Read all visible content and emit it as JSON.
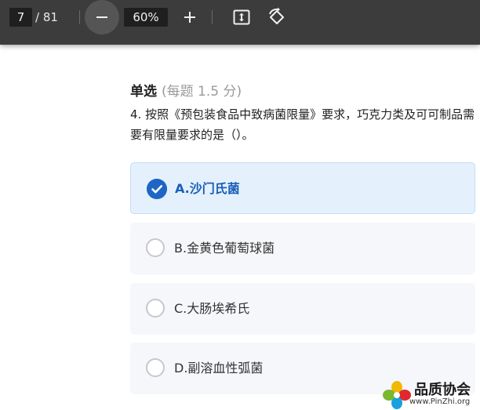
{
  "toolbar": {
    "current_page": "7",
    "page_total": "/ 81",
    "zoom": "60%",
    "zoom_out_icon": "minus-icon",
    "zoom_in_icon": "plus-icon",
    "fit_icon": "fit-to-page-icon",
    "rotate_icon": "rotate-icon"
  },
  "section": {
    "title": "单选",
    "meta": "(每题 1.5 分)"
  },
  "question": {
    "text": "4. 按照《预包装食品中致病菌限量》要求，巧克力类及可可制品需要有限量要求的是（）。"
  },
  "options": [
    {
      "label": "A.沙门氏菌",
      "selected": true
    },
    {
      "label": "B.金黄色葡萄球菌",
      "selected": false
    },
    {
      "label": "C.大肠埃希氏",
      "selected": false
    },
    {
      "label": "D.副溶血性弧菌",
      "selected": false
    }
  ],
  "watermark": {
    "title": "品质协会",
    "url": "www.PinZhi.org"
  },
  "colors": {
    "toolbar_bg": "#3c3c3c",
    "selected_accent": "#1e66c4",
    "selected_bg": "#e4f1fd",
    "option_bg": "#f5f7fa"
  }
}
